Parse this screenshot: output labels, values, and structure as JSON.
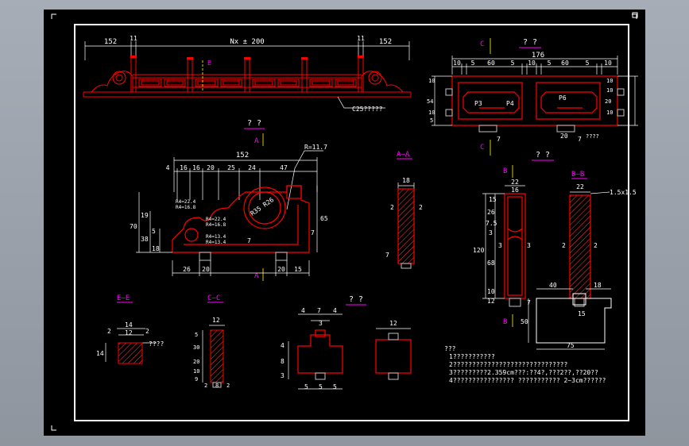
{
  "colors": {
    "background": "#000000",
    "viewport": "#9aa0a9",
    "frame": "#ffffff",
    "geometry": "#ff0000",
    "dimension": "#ffffff",
    "section_label": "#ff00ff",
    "accent": "#ffff00",
    "hatch": "#ff4040",
    "block": "#c0c0c0"
  },
  "railing": {
    "dims": [
      "152",
      "11",
      "Nx ± 200",
      "11",
      "152"
    ],
    "callout": "C25?????",
    "section_mark": "E"
  },
  "plan_view": {
    "title": "? ?",
    "section_mark": "C",
    "dims_top": [
      "10",
      "5",
      "60",
      "5",
      "10",
      "5",
      "60",
      "5",
      "10"
    ],
    "overall": "176",
    "labels": [
      "P3",
      "P4",
      "P6"
    ],
    "side_dims": [
      "10",
      "54",
      "10",
      "5",
      "10",
      "10",
      "20",
      "10"
    ],
    "bottom_dims": [
      "7",
      "20",
      "7"
    ],
    "note": "????"
  },
  "front_view": {
    "title": "? ?",
    "section_mark": "A",
    "overall": "152",
    "dims_top": [
      "4",
      "16",
      "16",
      "20",
      "25",
      "24",
      "47"
    ],
    "radius_note": "R=11.7",
    "circle_note": "R35 R26",
    "radii": [
      "R4=22.4",
      "R4=16.8",
      "R4=22.4",
      "R4=16.8",
      "R4=13.4",
      "R4=13.4"
    ],
    "dims_left": [
      "70",
      "19",
      "38",
      "5",
      "18"
    ],
    "dims_right": [
      "65",
      "7"
    ],
    "dims_bottom": [
      "26",
      "20",
      "20",
      "15"
    ],
    "mid_dim": "7"
  },
  "section_aa": {
    "title": "A—A",
    "width": "18",
    "side_left": "2",
    "side_right": "2",
    "bottom": "7"
  },
  "side_view": {
    "title": "? ?",
    "section_mark": "B",
    "top_dims": [
      "22",
      "16"
    ],
    "left_dims": [
      "15",
      "26",
      "7.5",
      "3",
      "68",
      "120",
      "10",
      "12"
    ],
    "mid_dims": [
      "3",
      "3"
    ],
    "right_dim": "7"
  },
  "section_bb": {
    "title": "B—B",
    "top_dim": "22",
    "chamfer": "1.5x1.5",
    "left_dim": "2",
    "right_dim": "2",
    "base_dims": [
      "40",
      "18",
      "50",
      "15",
      "75"
    ]
  },
  "section_ee": {
    "title": "E—E",
    "dims": [
      "14",
      "2",
      "12",
      "2",
      "14"
    ],
    "note": "????"
  },
  "section_cc": {
    "title": "C—C",
    "top": "12",
    "left_dims": [
      "5",
      "30",
      "20",
      "10",
      "9"
    ],
    "bottom": [
      "2",
      "8",
      "2"
    ]
  },
  "detail_block": {
    "title": "? ?",
    "top_dims": [
      "4",
      "7",
      "4",
      "3"
    ],
    "left_dims": [
      "4",
      "8",
      "3"
    ],
    "bottom_dims": [
      "5",
      "5",
      "5"
    ],
    "side_top": "12"
  },
  "notes": {
    "heading": "???",
    "lines": [
      "1???????????",
      "2??????????????????????????????",
      "3?????????2.359cm???:??4?,???2??,??20??",
      "4????????????????    ??????????? 2~3cm??????"
    ]
  }
}
